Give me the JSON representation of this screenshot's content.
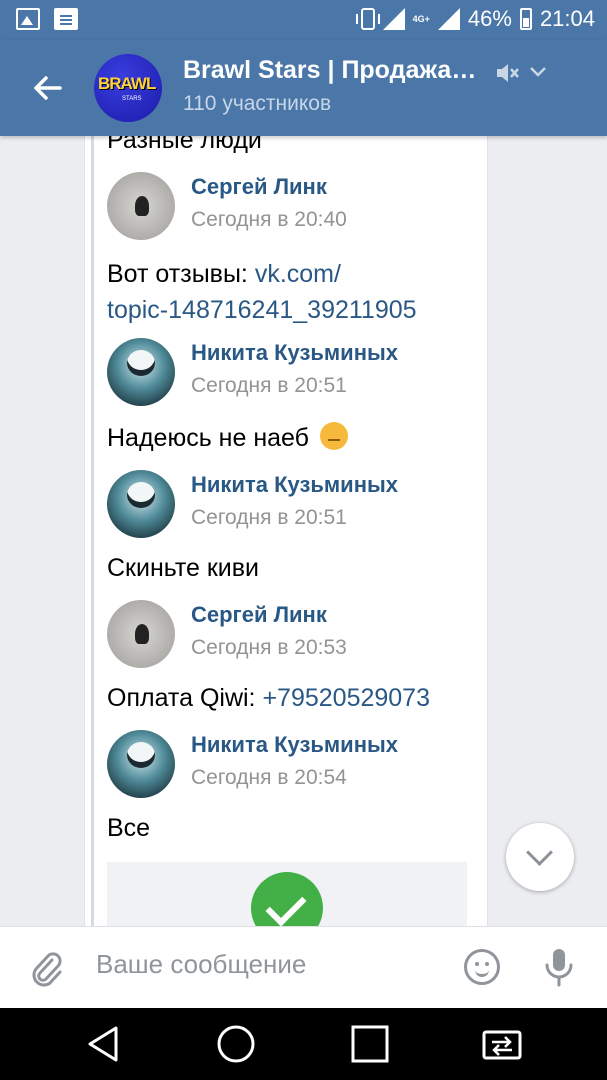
{
  "status_bar": {
    "battery_percent": "46%",
    "time": "21:04",
    "network": "4G+",
    "icons": [
      "image-icon",
      "message-icon",
      "vibrate-icon",
      "signal-icon",
      "signal-icon",
      "battery-icon"
    ]
  },
  "header": {
    "title": "Brawl Stars | Продажа…",
    "subtitle": "110 участников",
    "avatar_text": "BRAWL",
    "avatar_subtext": "STARS"
  },
  "messages": {
    "top_partial": "Разные люди",
    "m1_author": "Сергей Линк",
    "m1_time": "Сегодня в 20:40",
    "m1_text_prefix": "Вот отзывы: ",
    "m1_link_line1": "vk.com/",
    "m1_link_line2": "topic-148716241_39211905",
    "m2_author": "Никита Кузьминых",
    "m2_time": "Сегодня в 20:51",
    "m2_text": "Надеюсь не наеб",
    "m3_author": "Никита Кузьминых",
    "m3_time": "Сегодня в 20:51",
    "m3_text": "Скиньте киви",
    "m4_author": "Сергей Линк",
    "m4_time": "Сегодня в 20:53",
    "m4_text_prefix": "Оплата Qiwi: ",
    "m4_link": "+79520529073",
    "m5_author": "Никита Кузьминых",
    "m5_time": "Сегодня в 20:54",
    "m5_text": "Все"
  },
  "composer": {
    "placeholder": "Ваше сообщение"
  },
  "colors": {
    "header": "#4a76a8",
    "link": "#2a5885",
    "meta": "#939393"
  }
}
